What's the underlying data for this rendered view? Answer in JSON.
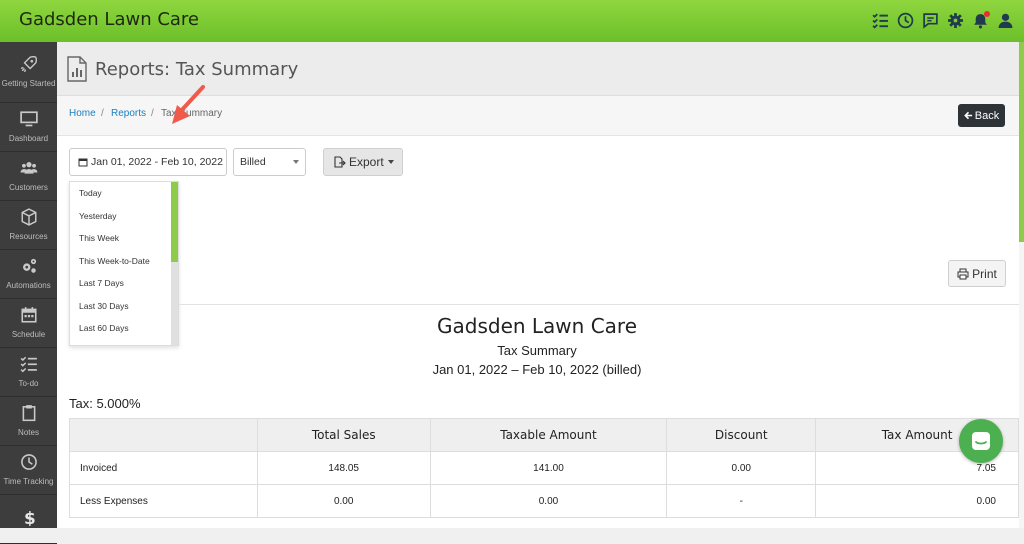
{
  "app": {
    "title": "Gadsden Lawn Care"
  },
  "topbar": {
    "icons": [
      "checklist-icon",
      "clock-icon",
      "message-icon",
      "gear-icon",
      "bell-icon",
      "user-icon"
    ]
  },
  "sidebar": {
    "items": [
      {
        "label": "Getting Started",
        "icon": "rocket-icon"
      },
      {
        "label": "Dashboard",
        "icon": "monitor-icon"
      },
      {
        "label": "Customers",
        "icon": "users-icon"
      },
      {
        "label": "Resources",
        "icon": "box-icon"
      },
      {
        "label": "Automations",
        "icon": "cogs-icon"
      },
      {
        "label": "Schedule",
        "icon": "calendar-icon"
      },
      {
        "label": "To-do",
        "icon": "checklist-icon"
      },
      {
        "label": "Notes",
        "icon": "clipboard-icon"
      },
      {
        "label": "Time Tracking",
        "icon": "clock-icon"
      },
      {
        "label": "",
        "icon": "dollar-icon"
      }
    ]
  },
  "page": {
    "title": "Reports: Tax Summary"
  },
  "breadcrumb": {
    "home": "Home",
    "reports": "Reports",
    "sep": "/",
    "current": "Tax Summary"
  },
  "toolbar": {
    "back": "Back",
    "date_range": "Jan 01, 2022 - Feb 10, 2022",
    "billed_select": "Billed",
    "export": "Export",
    "print": "Print"
  },
  "date_dropdown": [
    "Today",
    "Yesterday",
    "This Week",
    "This Week-to-Date",
    "Last 7 Days",
    "Last 30 Days",
    "Last 60 Days"
  ],
  "report": {
    "company": "Gadsden Lawn Care",
    "name": "Tax Summary",
    "range": "Jan 01, 2022 – Feb 10, 2022 (billed)",
    "tax_label": "Tax: 5.000%",
    "columns": [
      "",
      "Total Sales",
      "Taxable Amount",
      "Discount",
      "Tax Amount"
    ],
    "rows": [
      [
        "Invoiced",
        "148.05",
        "141.00",
        "0.00",
        "7.05"
      ],
      [
        "Less Expenses",
        "0.00",
        "0.00",
        "-",
        "0.00"
      ]
    ]
  },
  "colors": {
    "brand_green": "#7cc934",
    "sidebar_bg": "#3d3d3d",
    "link": "#1a7fc1",
    "annotation_arrow": "#f05a4a"
  }
}
